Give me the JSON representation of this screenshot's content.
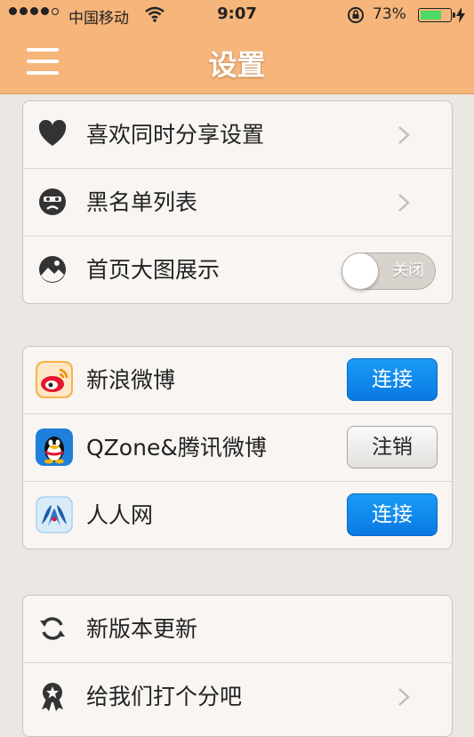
{
  "status_bar": {
    "carrier": "中国移动",
    "time": "9:07",
    "battery_percent": "73%",
    "battery_level": 0.73
  },
  "nav": {
    "title": "设置"
  },
  "groups": {
    "preferences": [
      {
        "label": "喜欢同时分享设置",
        "icon": "heart-icon"
      },
      {
        "label": "黑名单列表",
        "icon": "blacklist-face-icon"
      },
      {
        "label": "首页大图展示",
        "icon": "image-icon",
        "toggle_label": "关闭",
        "toggle_on": false
      }
    ],
    "accounts": [
      {
        "label": "新浪微博",
        "icon": "weibo-icon",
        "button": "连接",
        "button_style": "blue"
      },
      {
        "label": "QZone&腾讯微博",
        "icon": "qq-icon",
        "button": "注销",
        "button_style": "gray"
      },
      {
        "label": "人人网",
        "icon": "renren-icon",
        "button": "连接",
        "button_style": "blue"
      }
    ],
    "about": [
      {
        "label": "新版本更新",
        "icon": "refresh-icon"
      },
      {
        "label": "给我们打个分吧",
        "icon": "rating-badge-icon"
      }
    ]
  },
  "colors": {
    "nav_bg": "#f6b57a",
    "page_bg": "#ebe7e2",
    "connect_blue": "#1a9cf6"
  }
}
